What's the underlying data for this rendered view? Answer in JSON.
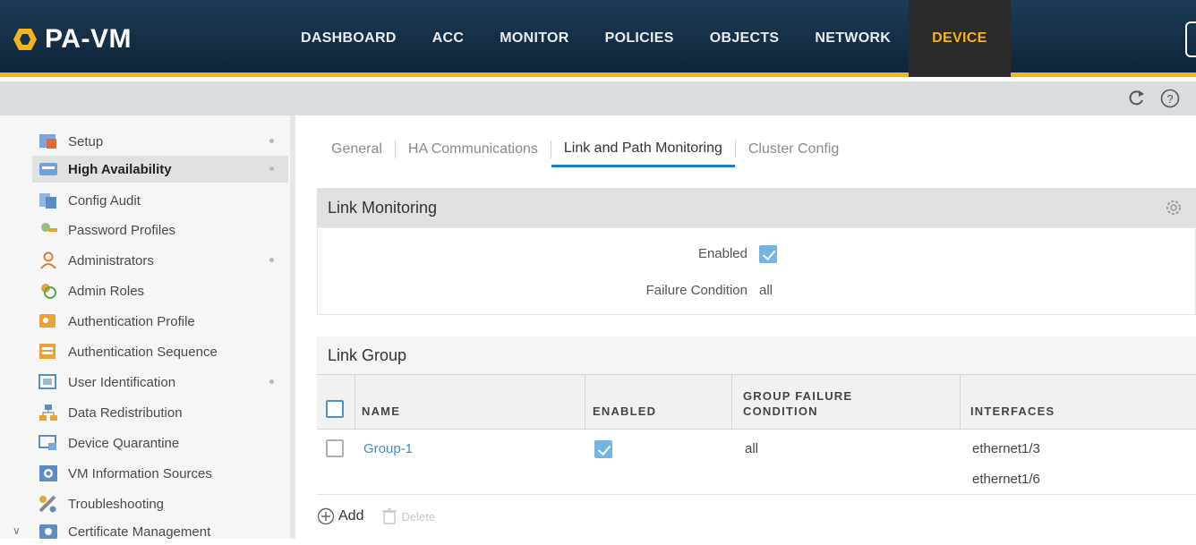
{
  "app": {
    "name": "PA-VM"
  },
  "nav": {
    "tabs": [
      "DASHBOARD",
      "ACC",
      "MONITOR",
      "POLICIES",
      "OBJECTS",
      "NETWORK",
      "DEVICE"
    ],
    "active": "DEVICE"
  },
  "toolbar": {
    "refresh_icon": "refresh-icon",
    "help_icon": "help-icon"
  },
  "sidebar": {
    "items": [
      {
        "label": "Setup",
        "icon": "setup-icon"
      },
      {
        "label": "High Availability",
        "icon": "high-availability-icon"
      },
      {
        "label": "Config Audit",
        "icon": "config-audit-icon"
      },
      {
        "label": "Password Profiles",
        "icon": "password-profiles-icon"
      },
      {
        "label": "Administrators",
        "icon": "administrators-icon"
      },
      {
        "label": "Admin Roles",
        "icon": "admin-roles-icon"
      },
      {
        "label": "Authentication Profile",
        "icon": "authentication-profile-icon"
      },
      {
        "label": "Authentication Sequence",
        "icon": "authentication-sequence-icon"
      },
      {
        "label": "User Identification",
        "icon": "user-identification-icon"
      },
      {
        "label": "Data Redistribution",
        "icon": "data-redistribution-icon"
      },
      {
        "label": "Device Quarantine",
        "icon": "device-quarantine-icon"
      },
      {
        "label": "VM Information Sources",
        "icon": "vm-information-sources-icon"
      },
      {
        "label": "Troubleshooting",
        "icon": "troubleshooting-icon"
      },
      {
        "label": "Certificate Management",
        "icon": "certificate-management-icon"
      }
    ]
  },
  "subtabs": [
    "General",
    "HA Communications",
    "Link and Path Monitoring",
    "Cluster Config"
  ],
  "link_monitoring": {
    "title": "Link Monitoring",
    "enabled_label": "Enabled",
    "enabled": true,
    "failure_label": "Failure Condition",
    "failure_value": "all"
  },
  "link_group": {
    "title": "Link Group",
    "columns": {
      "name": "NAME",
      "enabled": "ENABLED",
      "group_failure_1": "GROUP FAILURE",
      "group_failure_2": "CONDITION",
      "interfaces": "INTERFACES"
    },
    "rows": [
      {
        "name": "Group-1",
        "enabled": true,
        "condition": "all",
        "interfaces": [
          "ethernet1/3",
          "ethernet1/6"
        ]
      }
    ],
    "add_label": "Add",
    "delete_label": "Delete"
  }
}
